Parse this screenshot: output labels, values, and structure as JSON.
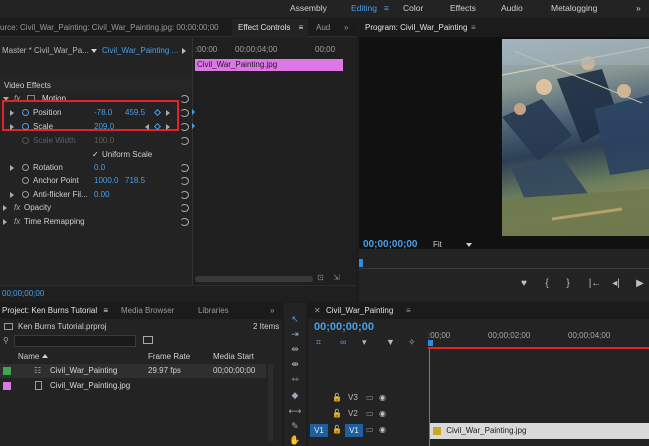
{
  "workspaces": {
    "items": [
      "Assembly",
      "Editing",
      "Color",
      "Effects",
      "Audio",
      "Metalogging"
    ],
    "active": "Editing",
    "menu_icon": "hamburger-icon",
    "more": "»"
  },
  "effect_panel": {
    "source_tab": "urce: Civil_War_Painting: Civil_War_Painting.jpg: 00;00;00;00",
    "effect_controls_tab": "Effect Controls",
    "audio_tab": "Aud",
    "master_label": "Master * Civil_War_Pa...",
    "clip_label": "Civil_War_Painting ...",
    "section_video_effects": "Video Effects",
    "motion": "Motion",
    "position_label": "Position",
    "position_x": "-78.0",
    "position_y": "459.5",
    "scale_label": "Scale",
    "scale_value": "209.0",
    "scale_width_label": "Scale Width",
    "scale_width_value": "100.0",
    "uniform_scale_label": "Uniform Scale",
    "rotation_label": "Rotation",
    "rotation_value": "0.0",
    "anchor_label": "Anchor Point",
    "anchor_x": "1000.0",
    "anchor_y": "718.5",
    "antiflicker_label": "Anti-flicker Fil...",
    "antiflicker_value": "0.00",
    "opacity_label": "Opacity",
    "time_remap_label": "Time Remapping",
    "fx_label": "fx",
    "time_0": ":00:00",
    "time_1": "00;00;04;00",
    "time_2": "00;00",
    "clip_bar_label": "Civil_War_Painting.jpg",
    "current_time": "00;00;00;00"
  },
  "program": {
    "title": "Program: Civil_War_Painting",
    "timecode": "00;00;00;00",
    "fit": "Fit"
  },
  "project": {
    "title": "Project: Ken Burns Tutorial",
    "tab_media_browser": "Media Browser",
    "tab_libraries": "Libraries",
    "file": "Ken Burns Tutorial.prproj",
    "item_count": "2 Items",
    "columns": [
      "Name",
      "Frame Rate",
      "Media Start"
    ],
    "rows": [
      {
        "name": "Civil_War_Painting",
        "fps": "29.97 fps",
        "start": "00;00;00;00",
        "color": "#3ea650",
        "icon": "sequence-icon"
      },
      {
        "name": "Civil_War_Painting.jpg",
        "fps": "",
        "start": "",
        "color": "#d97be0",
        "icon": "image-file-icon"
      }
    ]
  },
  "timeline": {
    "title": "Civil_War_Painting",
    "timecode": "00;00;00;00",
    "ruler": [
      ":00;00",
      "00;00;02;00",
      "00;00;04;00"
    ],
    "tracks": [
      "V3",
      "V2",
      "V1"
    ],
    "source_patch": "V1",
    "clip_label": "Civil_War_Painting.jpg"
  },
  "colors": {
    "accent_blue": "#4a9ee8",
    "highlight_red": "#e0242a",
    "clip_pink": "#dd77e6",
    "playhead": "#2f8be6"
  }
}
